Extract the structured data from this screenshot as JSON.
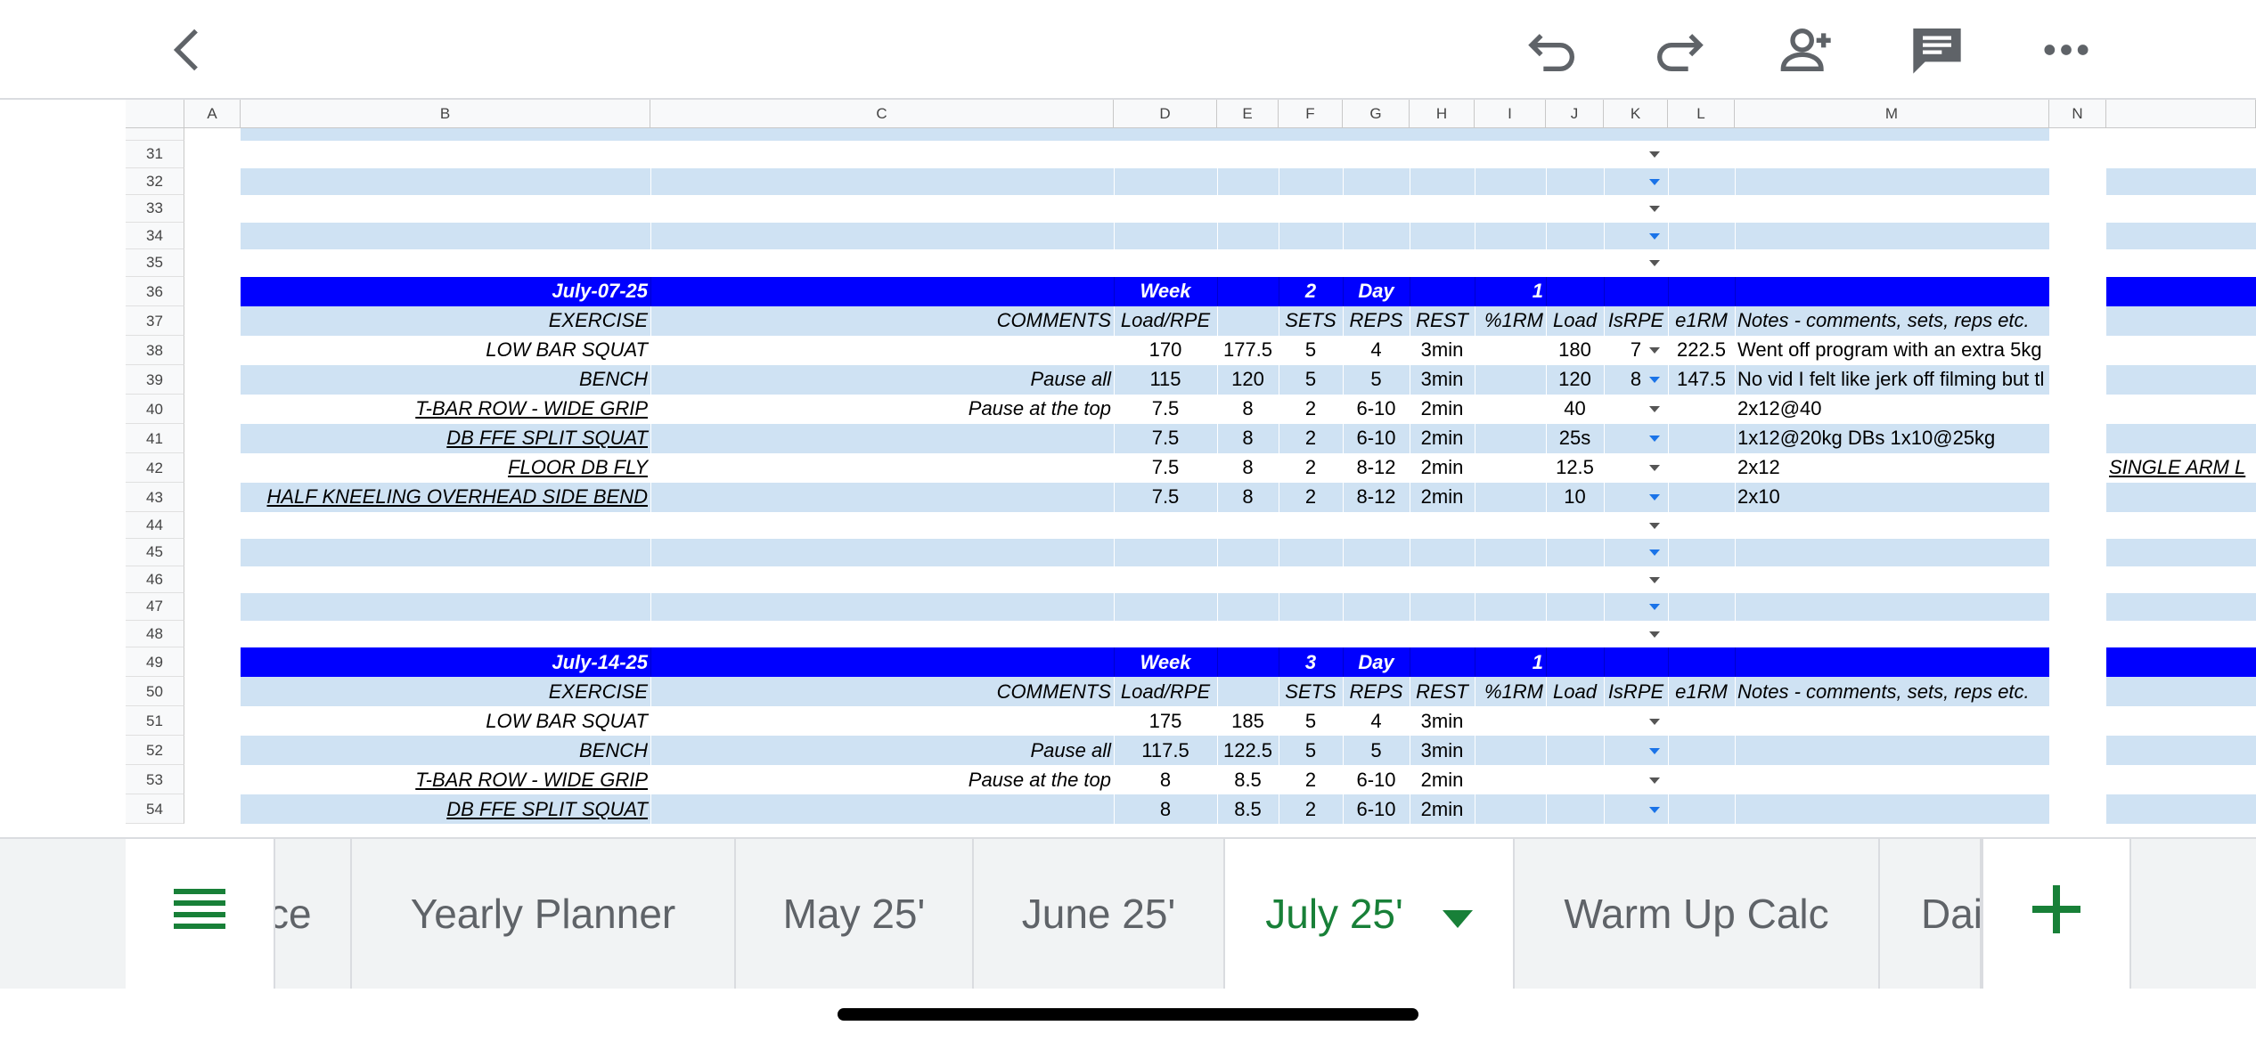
{
  "toolbar": {
    "back_icon": "chevron-left-icon",
    "undo_icon": "undo-icon",
    "redo_icon": "redo-icon",
    "share_icon": "add-person-icon",
    "comment_icon": "comment-icon",
    "more_icon": "more-horizontal-icon"
  },
  "columns": [
    "A",
    "B",
    "C",
    "D",
    "E",
    "F",
    "G",
    "H",
    "I",
    "J",
    "K",
    "L",
    "M",
    "N"
  ],
  "colors": {
    "header_blue": "#0000ff",
    "band_light": "#cfe2f3",
    "tab_active": "#188038"
  },
  "rows": [
    {
      "n": "31",
      "band": false,
      "dd": true
    },
    {
      "n": "32",
      "band": true,
      "dd": true
    },
    {
      "n": "33",
      "band": false,
      "dd": true
    },
    {
      "n": "34",
      "band": true,
      "dd": true
    },
    {
      "n": "35",
      "band": false,
      "dd": true
    },
    {
      "n": "36",
      "type": "header",
      "B": "July-07-25",
      "D": "Week",
      "F": "2",
      "G": "Day",
      "I": "1"
    },
    {
      "n": "37",
      "type": "colhead",
      "band": true,
      "B": "EXERCISE",
      "C": "COMMENTS",
      "D": "Load/RPE",
      "F": "SETS",
      "G": "REPS",
      "H": "REST",
      "I": "%1RM",
      "J": "Load",
      "K": "IsRPE",
      "L": "e1RM",
      "M": "Notes - comments, sets, reps etc."
    },
    {
      "n": "38",
      "band": false,
      "dd": true,
      "B": "LOW BAR SQUAT",
      "D": "170",
      "E": "177.5",
      "F": "5",
      "G": "4",
      "H": "3min",
      "J": "180",
      "K": "7",
      "L": "222.5",
      "M": "Went off program with an extra 5kg"
    },
    {
      "n": "39",
      "band": true,
      "dd": true,
      "B": "BENCH",
      "C": "Pause all",
      "D": "115",
      "E": "120",
      "F": "5",
      "G": "5",
      "H": "3min",
      "J": "120",
      "K": "8",
      "L": "147.5",
      "M": "No vid I felt like jerk off filming but tl"
    },
    {
      "n": "40",
      "band": false,
      "dd": true,
      "B": "T-BAR ROW - WIDE GRIP",
      "Blink": true,
      "C": "Pause at the top",
      "D": "7.5",
      "E": "8",
      "F": "2",
      "G": "6-10",
      "H": "2min",
      "J": "40",
      "M": "2x12@40"
    },
    {
      "n": "41",
      "band": true,
      "dd": true,
      "B": "DB FFE SPLIT SQUAT",
      "Blink": true,
      "D": "7.5",
      "E": "8",
      "F": "2",
      "G": "6-10",
      "H": "2min",
      "J": "25s",
      "M": "1x12@20kg DBs 1x10@25kg"
    },
    {
      "n": "42",
      "band": false,
      "dd": true,
      "B": "FLOOR DB FLY",
      "Blink": true,
      "D": "7.5",
      "E": "8",
      "F": "2",
      "G": "8-12",
      "H": "2min",
      "J": "12.5",
      "M": "2x12",
      "O": "SINGLE ARM L"
    },
    {
      "n": "43",
      "band": true,
      "dd": true,
      "B": "HALF KNEELING OVERHEAD SIDE BEND",
      "Blink": true,
      "D": "7.5",
      "E": "8",
      "F": "2",
      "G": "8-12",
      "H": "2min",
      "J": "10",
      "M": "2x10"
    },
    {
      "n": "44",
      "band": false,
      "dd": true
    },
    {
      "n": "45",
      "band": true,
      "dd": true
    },
    {
      "n": "46",
      "band": false,
      "dd": true
    },
    {
      "n": "47",
      "band": true,
      "dd": true
    },
    {
      "n": "48",
      "band": false,
      "dd": true
    },
    {
      "n": "49",
      "type": "header",
      "B": "July-14-25",
      "D": "Week",
      "F": "3",
      "G": "Day",
      "I": "1"
    },
    {
      "n": "50",
      "type": "colhead",
      "band": true,
      "B": "EXERCISE",
      "C": "COMMENTS",
      "D": "Load/RPE",
      "F": "SETS",
      "G": "REPS",
      "H": "REST",
      "I": "%1RM",
      "J": "Load",
      "K": "IsRPE",
      "L": "e1RM",
      "M": "Notes - comments, sets, reps etc."
    },
    {
      "n": "51",
      "band": false,
      "dd": true,
      "B": "LOW BAR SQUAT",
      "D": "175",
      "E": "185",
      "F": "5",
      "G": "4",
      "H": "3min"
    },
    {
      "n": "52",
      "band": true,
      "dd": true,
      "B": "BENCH",
      "C": "Pause all",
      "D": "117.5",
      "E": "122.5",
      "F": "5",
      "G": "5",
      "H": "3min"
    },
    {
      "n": "53",
      "band": false,
      "dd": true,
      "B": "T-BAR ROW - WIDE GRIP",
      "Blink": true,
      "C": "Pause at the top",
      "D": "8",
      "E": "8.5",
      "F": "2",
      "G": "6-10",
      "H": "2min"
    },
    {
      "n": "54",
      "band": true,
      "dd": true,
      "B": "DB FFE SPLIT SQUAT",
      "Blink": true,
      "D": "8",
      "E": "8.5",
      "F": "2",
      "G": "6-10",
      "H": "2min"
    }
  ],
  "tabs": [
    {
      "label": "ce",
      "active": false
    },
    {
      "label": "Yearly Planner",
      "active": false
    },
    {
      "label": "May 25'",
      "active": false
    },
    {
      "label": "June 25'",
      "active": false
    },
    {
      "label": "July 25'",
      "active": true
    },
    {
      "label": "Warm Up Calc",
      "active": false
    },
    {
      "label": "Dai",
      "active": false
    }
  ],
  "tabbar": {
    "all_sheets_icon": "sheets-list-icon",
    "add_icon": "plus-icon",
    "active_dropdown_icon": "triangle-down-icon"
  }
}
